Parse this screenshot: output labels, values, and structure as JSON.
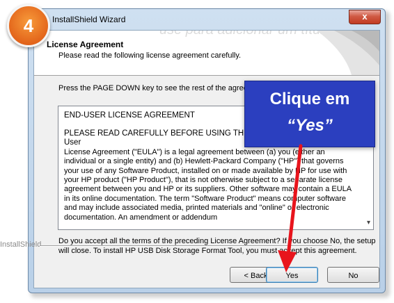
{
  "window": {
    "title": "InstallShield Wizard",
    "close_glyph": "x"
  },
  "header": {
    "background_text": "use para adicionar um título",
    "title": "License Agreement",
    "subtitle": "Please read the following license agreement carefully."
  },
  "instruction": "Press the PAGE DOWN key to see the rest of the agreement.",
  "eula": {
    "heading": "END-USER LICENSE AGREEMENT",
    "lead": "PLEASE READ CAREFULLY BEFORE USING THIS EQUIPMENT: This End-User",
    "body": "License Agreement (\"EULA\") is a legal agreement between (a) you (either an individual or a single entity) and (b) Hewlett-Packard Company (\"HP\") that governs your use of any Software Product, installed on or made available by HP for use with your HP product (\"HP Product\"), that is not otherwise subject to a separate license agreement between you and HP or its suppliers. Other software may contain a EULA in its online documentation. The term \"Software Product\" means computer software and may include associated media, printed materials and \"online\" or electronic documentation. An amendment or addendum",
    "scroll_glyph": "▾"
  },
  "question": "Do you accept all the terms of the preceding License Agreement?  If you choose No,  the setup will close.  To install HP USB Disk Storage Format Tool, you must accept this agreement.",
  "brand": "InstallShield",
  "buttons": {
    "back": "< Back",
    "yes": "Yes",
    "no": "No"
  },
  "overlay": {
    "step_number": "4",
    "callout_line1": "Clique em",
    "callout_line2": "“Yes”",
    "accent_color": "#2b3fbf",
    "arrow_color": "#e8141c",
    "badge_color": "#e3651b"
  }
}
